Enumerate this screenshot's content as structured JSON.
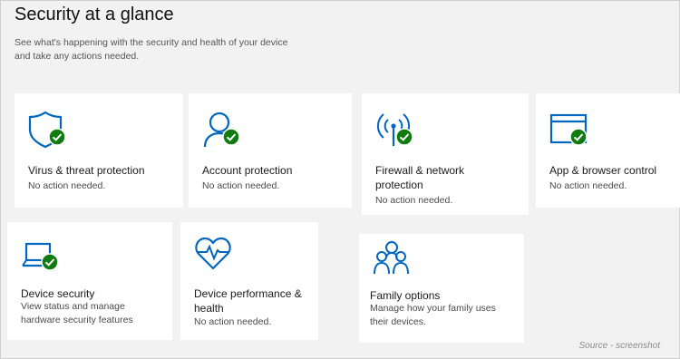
{
  "page": {
    "title": "Security at a glance",
    "description": "See what's happening with the security and health of your device and take any actions needed."
  },
  "colors": {
    "accent": "#0067c0",
    "check": "#107c10",
    "tile_bg": "#ffffff",
    "page_bg": "#f2f2f2"
  },
  "tiles": [
    {
      "name": "Virus & threat protection",
      "status": "No action needed.",
      "icon": "shield-icon",
      "ok": true
    },
    {
      "name": "Account protection",
      "status": "No action needed.",
      "icon": "person-icon",
      "ok": true
    },
    {
      "name": "Firewall & network protection",
      "status": "No action needed.",
      "icon": "antenna-icon",
      "ok": true
    },
    {
      "name": "App & browser control",
      "status": "No action needed.",
      "icon": "browser-window-icon",
      "ok": true
    },
    {
      "name": "Device security",
      "status": "View status and manage hardware security features",
      "icon": "laptop-icon",
      "ok": true
    },
    {
      "name": "Device performance & health",
      "status": "No action needed.",
      "icon": "heart-pulse-icon",
      "ok": false
    },
    {
      "name": "Family options",
      "status": "Manage how your family uses their devices.",
      "icon": "family-icon",
      "ok": false
    }
  ],
  "footer": {
    "source": "Source - screenshot"
  }
}
